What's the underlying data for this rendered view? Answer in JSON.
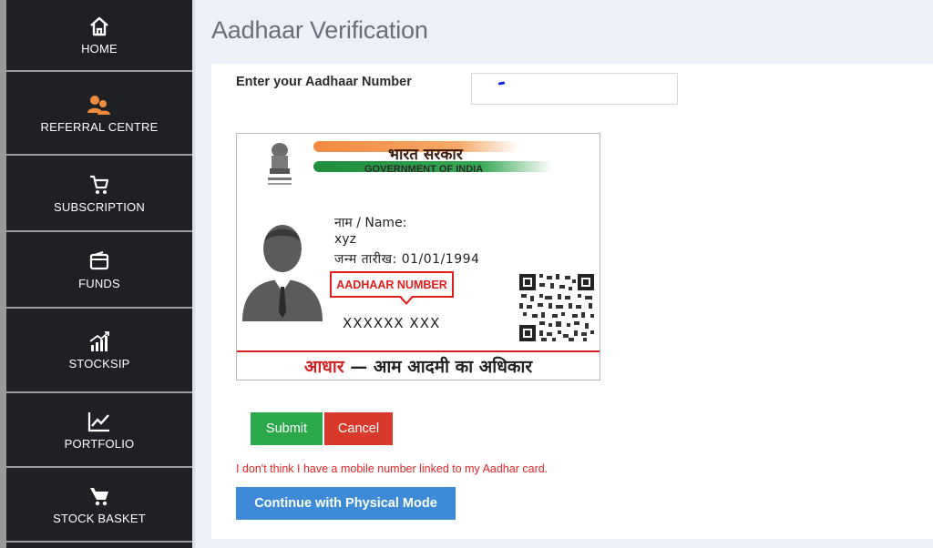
{
  "sidebar": {
    "items": [
      {
        "label": "HOME",
        "icon": "home-icon"
      },
      {
        "label": "REFERRAL CENTRE",
        "icon": "referral-icon"
      },
      {
        "label": "SUBSCRIPTION",
        "icon": "cart-icon"
      },
      {
        "label": "FUNDS",
        "icon": "wallet-icon"
      },
      {
        "label": "STOCKSIP",
        "icon": "growth-bars-icon"
      },
      {
        "label": "PORTFOLIO",
        "icon": "chart-line-icon"
      },
      {
        "label": "STOCK BASKET",
        "icon": "basket-icon"
      }
    ]
  },
  "main": {
    "title": "Aadhaar Verification",
    "aadhaar_label": "Enter your Aadhaar Number",
    "aadhaar_value": "",
    "card": {
      "hindi_gov": "भारत सरकार",
      "english_gov": "GOVERNMENT OF INDIA",
      "name_label": "नाम / Name:",
      "name_value": "xyz",
      "dob": "जन्म तारीख: 01/01/1994",
      "callout": "AADHAAR NUMBER",
      "aadhaar_number": "XXXXXX XXX",
      "footer_red": "आधार",
      "footer_rest": " — आम आदमी का अधिकार"
    },
    "submit_label": "Submit",
    "cancel_label": "Cancel",
    "mobile_link": "I don't think I have a mobile number linked to my Aadhar card.",
    "physical_label": "Continue with Physical Mode"
  },
  "colors": {
    "sidebar_bg": "#1e2024",
    "submit": "#2aa84a",
    "cancel": "#d9392b",
    "physical": "#3d8bd6",
    "link_red": "#e5262a",
    "referral_accent": "#f08a3c"
  }
}
